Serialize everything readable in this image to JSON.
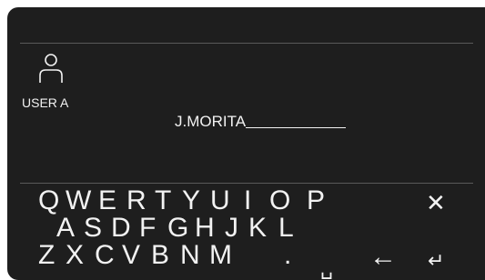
{
  "user": {
    "label": "USER A"
  },
  "name_field": {
    "value": "J.MORITA"
  },
  "keyboard": {
    "row1": [
      "Q",
      "W",
      "E",
      "R",
      "T",
      "Y",
      "U",
      "I",
      "O",
      "P"
    ],
    "row2": [
      "A",
      "S",
      "D",
      "F",
      "G",
      "H",
      "J",
      "K",
      "L"
    ],
    "row3": [
      "Z",
      "X",
      "C",
      "V",
      "B",
      "N",
      "M",
      "."
    ],
    "space_key": "␣",
    "close_key": "✕",
    "backspace_key": "←",
    "enter_key": "↵"
  },
  "colors": {
    "panel_background": "#1e1e1e",
    "text": "#f2f2f2",
    "divider": "#5a5a5a"
  }
}
